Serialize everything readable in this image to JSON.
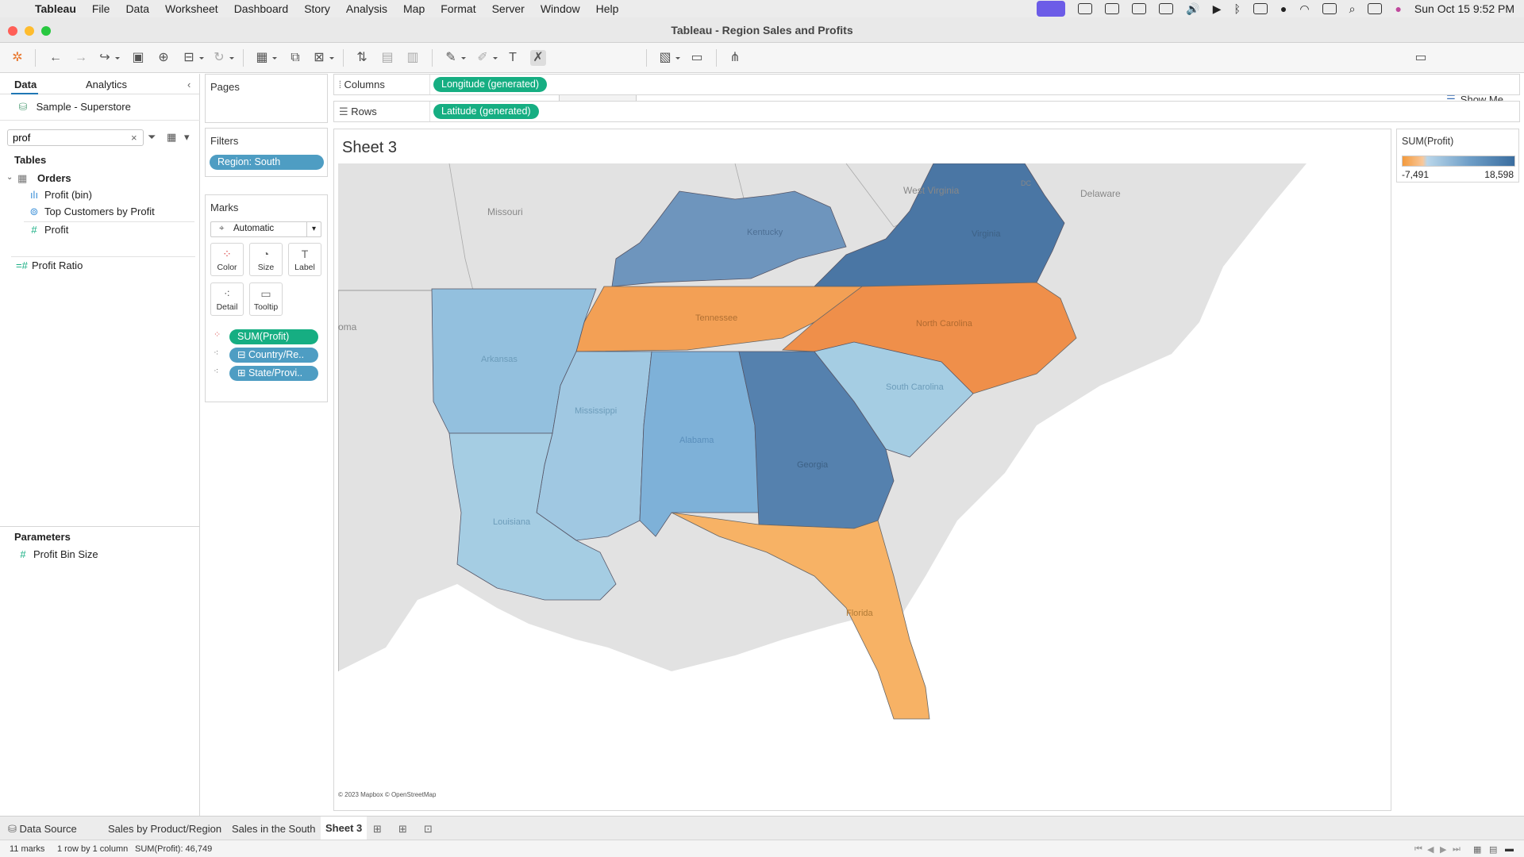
{
  "menubar": {
    "app": "Tableau",
    "items": [
      "File",
      "Data",
      "Worksheet",
      "Dashboard",
      "Story",
      "Analysis",
      "Map",
      "Format",
      "Server",
      "Window",
      "Help"
    ],
    "datetime": "Sun Oct 15  9:52 PM"
  },
  "window": {
    "title": "Tableau - Region Sales and Profits"
  },
  "toolbar": {
    "show_me": "Show Me"
  },
  "left": {
    "tab_data": "Data",
    "tab_analytics": "Analytics",
    "datasource": "Sample - Superstore",
    "search_value": "prof",
    "tables_header": "Tables",
    "table_name": "Orders",
    "fields": [
      "Profit (bin)",
      "Top Customers by Profit",
      "Profit"
    ],
    "extra_field": "Profit Ratio",
    "parameters_header": "Parameters",
    "parameter": "Profit Bin Size"
  },
  "cards": {
    "pages": "Pages",
    "filters": "Filters",
    "filter_pill": "Region: South",
    "marks": "Marks",
    "mark_type": "Automatic",
    "mark_buttons": [
      "Color",
      "Size",
      "Label",
      "Detail",
      "Tooltip"
    ],
    "mark_pills": [
      "SUM(Profit)",
      "Country/Re..",
      "State/Provi.."
    ]
  },
  "shelves": {
    "columns_label": "Columns",
    "columns_pill": "Longitude (generated)",
    "rows_label": "Rows",
    "rows_pill": "Latitude (generated)"
  },
  "sheet": {
    "title": "Sheet 3",
    "attribution": "© 2023 Mapbox © OpenStreetMap"
  },
  "map": {
    "context_labels": [
      "Missouri",
      "West Virginia",
      "Delaware",
      "oma",
      "DC"
    ],
    "state_labels": [
      "Kentucky",
      "Virginia",
      "Tennessee",
      "North Carolina",
      "Arkansas",
      "Mississippi",
      "Alabama",
      "Georgia",
      "South Carolina",
      "Louisiana",
      "Florida"
    ],
    "colors": {
      "land": "#e2e2e2",
      "water": "#ffffff",
      "orange_strong": "#ef8f4a",
      "orange_mid": "#f3a055",
      "orange_light": "#f7b265",
      "blue_dark": "#4a76a4",
      "blue_mid": "#5d86b3",
      "blue_med": "#7aa4cc",
      "blue_light": "#93c0de",
      "blue_lighter": "#a5cde3"
    }
  },
  "legend": {
    "title": "SUM(Profit)",
    "min": "-7,491",
    "max": "18,598",
    "gradient_start": "#f39a3c",
    "gradient_end": "#3a6d9f"
  },
  "bottom": {
    "tabs": [
      "Data Source",
      "Sales by Product/Region",
      "Sales in the South",
      "Sheet 3"
    ],
    "status_marks": "11 marks",
    "status_dims": "1 row by 1 column",
    "status_sum": "SUM(Profit): 46,749"
  }
}
